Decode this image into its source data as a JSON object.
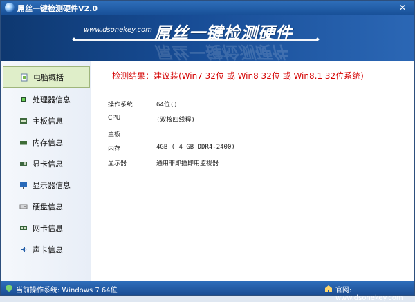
{
  "window": {
    "title": "屌丝一键检测硬件V2.0",
    "minimize_label": "—",
    "close_label": "✕"
  },
  "banner": {
    "url": "www.dsonekey.com",
    "title": "屌丝一键检测硬件"
  },
  "sidebar": {
    "items": [
      {
        "label": "电脑概括",
        "icon": "computer-overview-icon"
      },
      {
        "label": "处理器信息",
        "icon": "cpu-icon"
      },
      {
        "label": "主板信息",
        "icon": "motherboard-icon"
      },
      {
        "label": "内存信息",
        "icon": "memory-icon"
      },
      {
        "label": "显卡信息",
        "icon": "graphics-card-icon"
      },
      {
        "label": "显示器信息",
        "icon": "monitor-icon"
      },
      {
        "label": "硬盘信息",
        "icon": "hard-disk-icon"
      },
      {
        "label": "网卡信息",
        "icon": "network-card-icon"
      },
      {
        "label": "声卡信息",
        "icon": "sound-card-icon"
      }
    ]
  },
  "content": {
    "result": "检测结果：建议装(Win7 32位 或 Win8 32位 或 Win8.1 32位系统)",
    "rows": [
      {
        "label": "操作系统",
        "value": "64位()"
      },
      {
        "label": "CPU",
        "value": "(双核四线程)"
      },
      {
        "label": "主板",
        "value": ""
      },
      {
        "label": "内存",
        "value": "4GB ( 4 GB DDR4-2400)"
      },
      {
        "label": "显示器",
        "value": "通用非即插即用监视器"
      }
    ]
  },
  "status": {
    "left": "当前操作系统: Windows 7 64位",
    "right": "官网: www.dsonekey.com"
  },
  "colors": {
    "accent": "#1f5fae",
    "result_text": "#d40000",
    "active_nav": "#dfeec9"
  }
}
